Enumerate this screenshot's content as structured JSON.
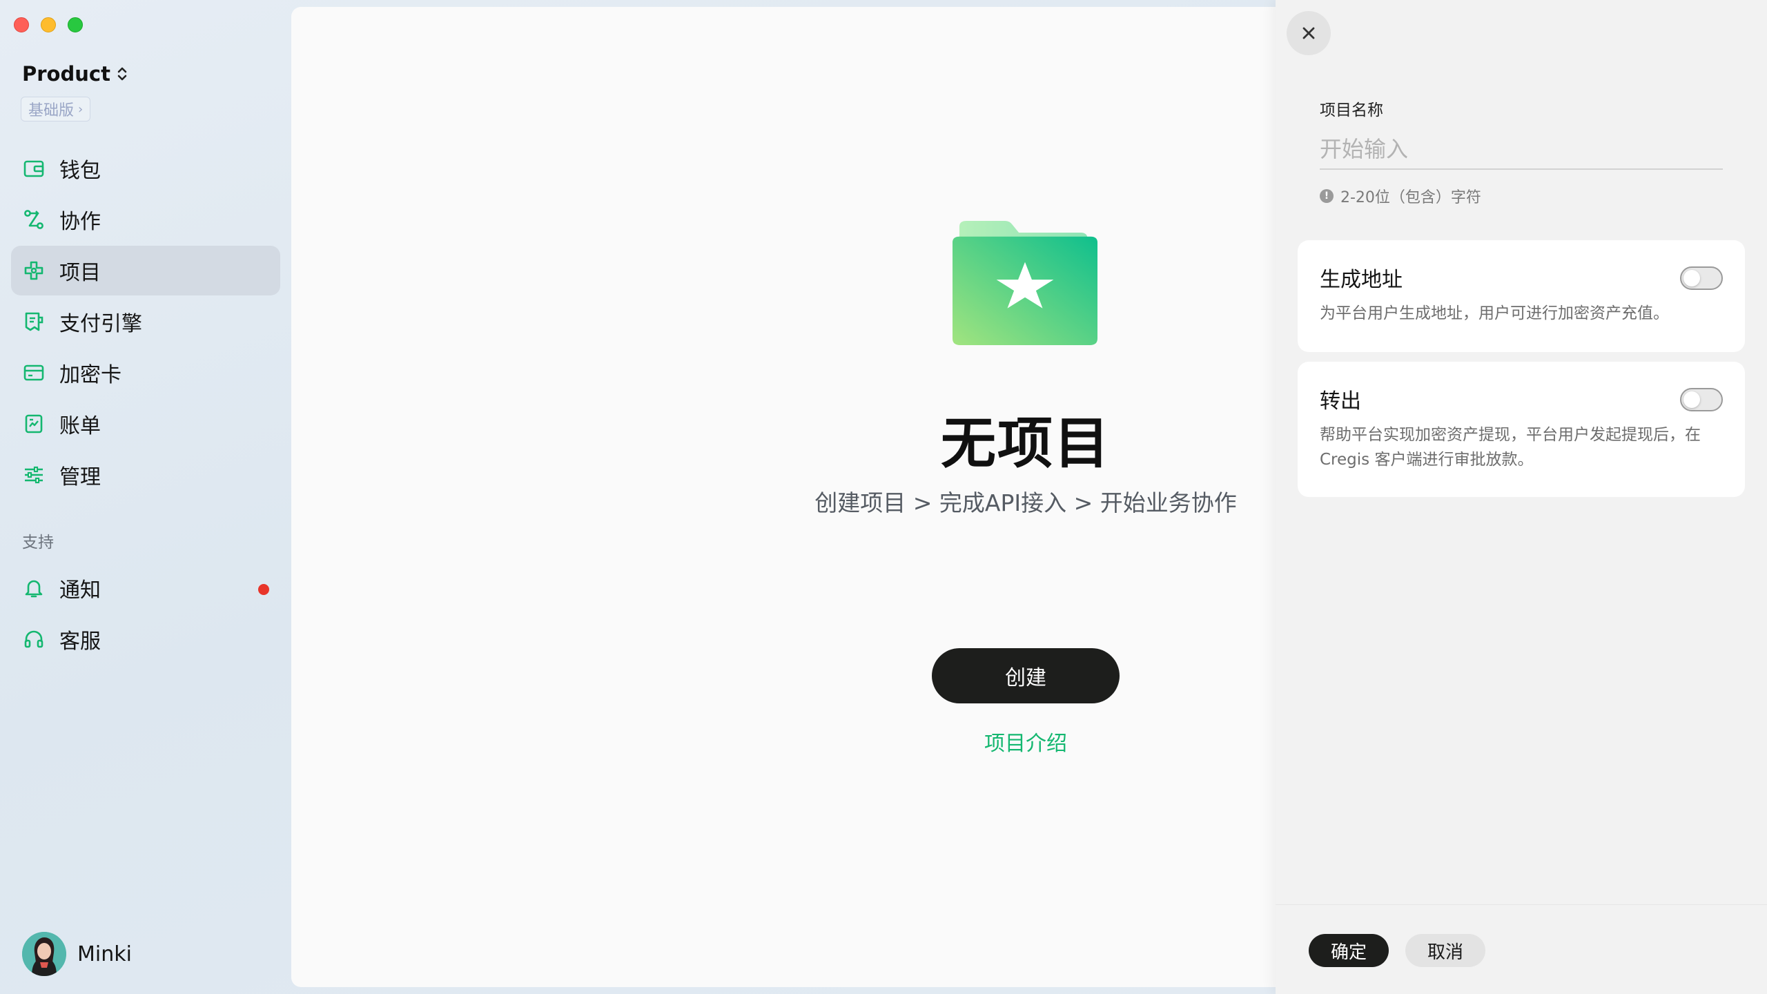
{
  "window": {
    "controls": [
      "close",
      "minimize",
      "zoom"
    ]
  },
  "sidebar": {
    "workspace": "Product",
    "plan": "基础版",
    "items": [
      {
        "label": "钱包",
        "icon": "wallet-icon"
      },
      {
        "label": "协作",
        "icon": "collaboration-icon"
      },
      {
        "label": "项目",
        "icon": "project-icon",
        "active": true
      },
      {
        "label": "支付引擎",
        "icon": "payment-engine-icon"
      },
      {
        "label": "加密卡",
        "icon": "card-icon"
      },
      {
        "label": "账单",
        "icon": "bill-icon"
      },
      {
        "label": "管理",
        "icon": "sliders-icon"
      }
    ],
    "support_label": "支持",
    "support_items": [
      {
        "label": "通知",
        "icon": "bell-icon",
        "badge": "red-dot"
      },
      {
        "label": "客服",
        "icon": "headset-icon"
      }
    ],
    "user": {
      "name": "Minki"
    }
  },
  "main": {
    "empty_title": "无项目",
    "empty_subtitle": "创建项目 > 完成API接入 > 开始业务协作",
    "create_button": "创建",
    "intro_link": "项目介绍"
  },
  "drawer": {
    "name_label": "项目名称",
    "name_placeholder": "开始输入",
    "name_value": "",
    "name_hint": "2-20位（包含）字符",
    "options": [
      {
        "title": "生成地址",
        "description": "为平台用户生成地址，用户可进行加密资产充值。",
        "enabled": false
      },
      {
        "title": "转出",
        "description": "帮助平台实现加密资产提现，平台用户发起提现后，在 Cregis 客户端进行审批放款。",
        "enabled": false
      }
    ],
    "confirm_button": "确定",
    "cancel_button": "取消"
  },
  "colors": {
    "accent": "#14b770",
    "active_bg": "#d3dae3",
    "dark_button": "#1d1e1c",
    "notification": "#e8352a"
  }
}
